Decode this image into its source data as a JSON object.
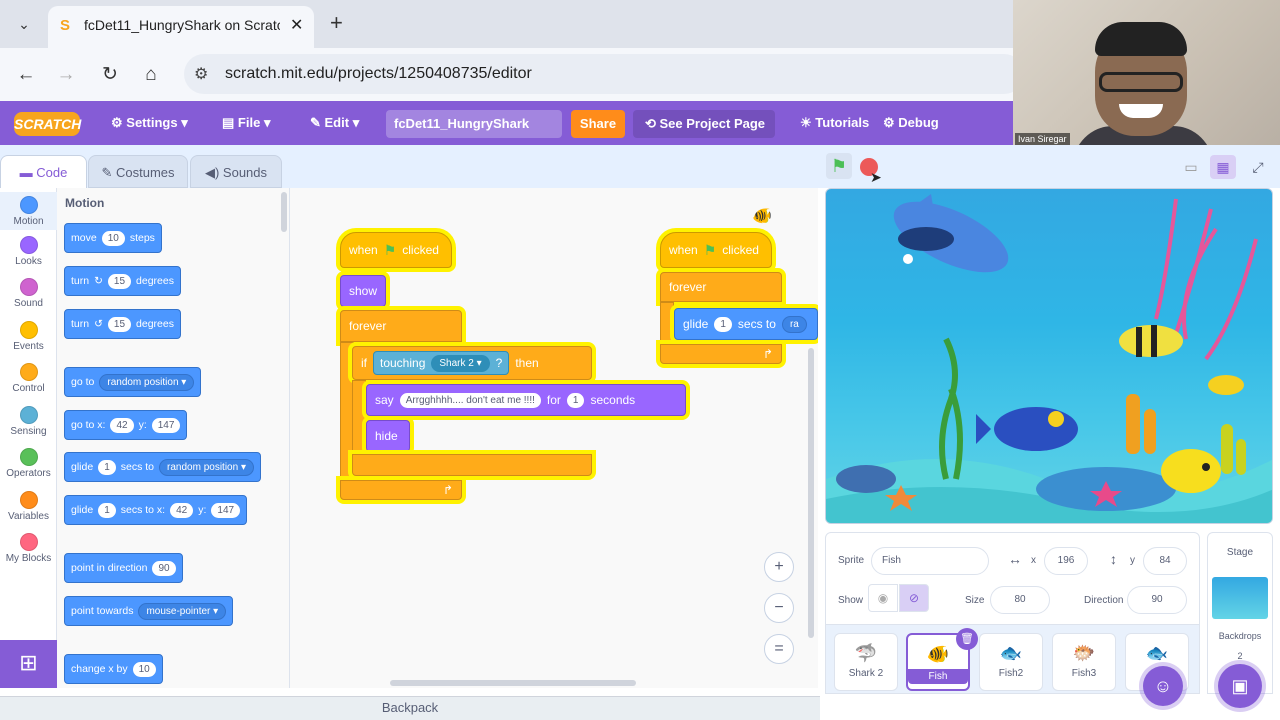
{
  "browser": {
    "tab_title": "fcDet11_HungryShark on Scratch",
    "url": "scratch.mit.edu/projects/1250408735/editor",
    "favicon": "S"
  },
  "menu": {
    "logo": "SCRATCH",
    "settings": "Settings",
    "file": "File",
    "edit": "Edit",
    "project_title": "fcDet11_HungryShark",
    "share": "Share",
    "see_project_page": "See Project Page",
    "tutorials": "Tutorials",
    "debug": "Debug"
  },
  "webcam": {
    "name": "Ivan Siregar"
  },
  "editor_tabs": {
    "code": "Code",
    "costumes": "Costumes",
    "sounds": "Sounds"
  },
  "categories": [
    "Motion",
    "Looks",
    "Sound",
    "Events",
    "Control",
    "Sensing",
    "Operators",
    "Variables",
    "My Blocks"
  ],
  "category_colors": [
    "#4c97ff",
    "#9966ff",
    "#cf63cf",
    "#ffbf00",
    "#ffab19",
    "#5cb1d6",
    "#59c059",
    "#ff8c1a",
    "#ff6680"
  ],
  "palette": {
    "title": "Motion",
    "move": {
      "a": "move",
      "n": "10",
      "b": "steps"
    },
    "turn_right": {
      "a": "turn",
      "n": "15",
      "b": "degrees"
    },
    "turn_left": {
      "a": "turn",
      "n": "15",
      "b": "degrees"
    },
    "goto": {
      "a": "go to",
      "dd": "random position"
    },
    "gotoxy": {
      "a": "go to x:",
      "x": "42",
      "ylabel": "y:",
      "y": "147"
    },
    "glide": {
      "a": "glide",
      "n": "1",
      "b": "secs to",
      "dd": "random position"
    },
    "glidexy": {
      "a": "glide",
      "n": "1",
      "b": "secs to x:",
      "x": "42",
      "ylabel": "y:",
      "y": "147"
    },
    "point_dir": {
      "a": "point in direction",
      "n": "90"
    },
    "point_towards": {
      "a": "point towards",
      "dd": "mouse-pointer"
    },
    "change_x": {
      "a": "change x by",
      "n": "10"
    }
  },
  "script1": {
    "when": "when",
    "clicked": "clicked",
    "show": "show",
    "forever": "forever",
    "if": "if",
    "touching": "touching",
    "touching_target": "Shark 2",
    "q": "?",
    "then": "then",
    "say": "say",
    "say_text": "Arrgghhhh.... don't eat me !!!!",
    "for": "for",
    "secs": "1",
    "seconds": "seconds",
    "hide": "hide"
  },
  "script2": {
    "when": "when",
    "clicked": "clicked",
    "forever": "forever",
    "glide": "glide",
    "secs": "1",
    "secs_to": "secs to",
    "target": "ra"
  },
  "zoom": {
    "in": "+",
    "out": "−",
    "reset": "="
  },
  "backpack": "Backpack",
  "sprite_info": {
    "sprite_label": "Sprite",
    "sprite_name": "Fish",
    "x_label": "x",
    "x": "196",
    "y_label": "y",
    "y": "84",
    "show_label": "Show",
    "size_label": "Size",
    "size": "80",
    "direction_label": "Direction",
    "direction": "90"
  },
  "sprites": [
    {
      "name": "Shark 2",
      "icon": "🦈"
    },
    {
      "name": "Fish",
      "icon": "🐠"
    },
    {
      "name": "Fish2",
      "icon": "🐟"
    },
    {
      "name": "Fish3",
      "icon": "🐡"
    },
    {
      "name": "",
      "icon": "🐟"
    }
  ],
  "stage_panel": {
    "title": "Stage",
    "backdrops_label": "Backdrops",
    "backdrops_count": "2"
  }
}
